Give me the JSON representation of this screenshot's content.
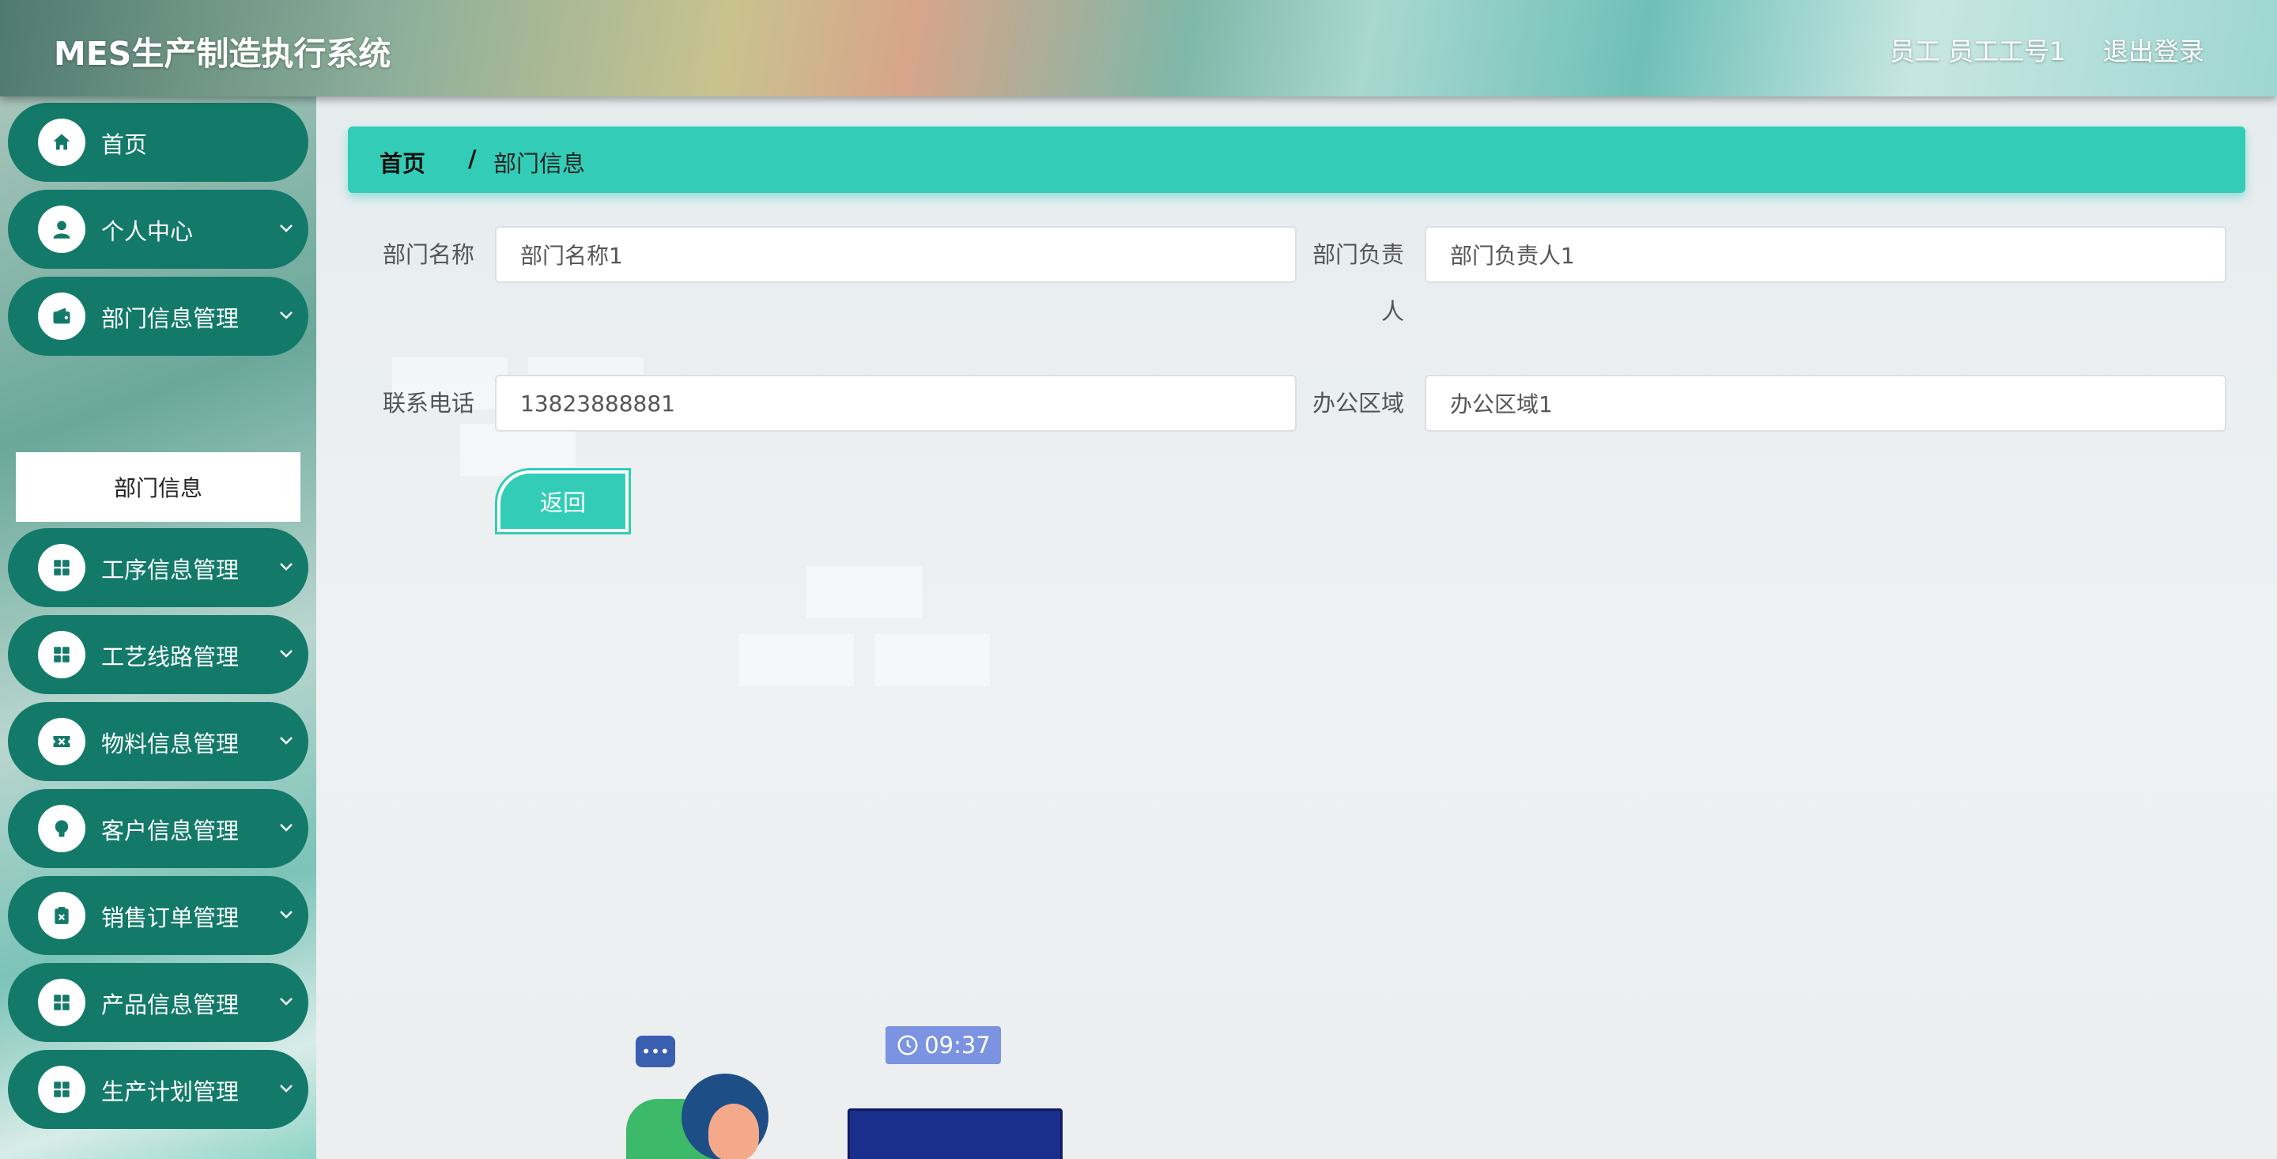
{
  "header": {
    "title": "MES生产制造执行系统",
    "user": "员工 员工工号1",
    "logout": "退出登录"
  },
  "sidebar": {
    "items": [
      {
        "label": "首页",
        "icon": "home-icon"
      },
      {
        "label": "个人中心",
        "icon": "user-icon"
      },
      {
        "label": "部门信息管理",
        "icon": "wallet-icon"
      },
      {
        "label": "工序信息管理",
        "icon": "grid-icon"
      },
      {
        "label": "工艺线路管理",
        "icon": "grid-icon"
      },
      {
        "label": "物料信息管理",
        "icon": "ticket-icon"
      },
      {
        "label": "客户信息管理",
        "icon": "bulb-icon"
      },
      {
        "label": "销售订单管理",
        "icon": "clipboard-icon"
      },
      {
        "label": "产品信息管理",
        "icon": "grid-icon"
      },
      {
        "label": "生产计划管理",
        "icon": "grid-icon"
      }
    ],
    "submenu": {
      "label": "部门信息"
    }
  },
  "breadcrumb": {
    "home": "首页",
    "separator": "/",
    "current": "部门信息"
  },
  "form": {
    "dept_name_label": "部门名称",
    "dept_name_value": "部门名称1",
    "dept_head_label": "部门负责人",
    "dept_head_value": "部门负责人1",
    "phone_label": "联系电话",
    "phone_value": "13823888881",
    "office_label": "办公区域",
    "office_value": "办公区域1",
    "back_label": "返回"
  },
  "illustration": {
    "clock_time": "09:37",
    "chat_dots": "•••"
  },
  "colors": {
    "menu_bg": "#137a69",
    "accent": "#33cdb7",
    "laptop": "#1a2f8c",
    "clock_badge": "#7b93e0"
  }
}
